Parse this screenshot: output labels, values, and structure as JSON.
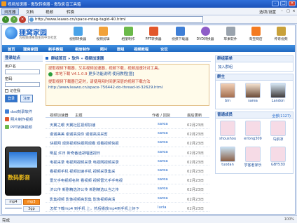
{
  "window": {
    "title": "视频加速器 - 傲软转换器 - 傲软影音工具箱"
  },
  "menubar": {
    "items": [
      "浏览器",
      "文档",
      "视频",
      "转换"
    ],
    "tool": "选项/设置"
  },
  "address": {
    "url": "http://www.leawo.cn/space-mtag-tagid-40.html"
  },
  "site": {
    "logo": "狸窝家园",
    "logo_sub": "为视频转换而生的中文社区",
    "top_icons": [
      "视频转换器",
      "视频剪辑",
      "相册制作",
      "PPT转换器",
      "视频下载器",
      "DVD转换器",
      "苹果软件",
      "淘宝网店",
      "传奇视频"
    ],
    "nav": [
      "首页",
      "狸窝家园",
      "新手教程",
      "相册制作",
      "照片",
      "群组",
      "视频教程",
      "论坛"
    ]
  },
  "login": {
    "title": "登录站点",
    "user_label": "用户名",
    "pass_label": "密码",
    "remember": "记住我",
    "login_btn": "登录",
    "register_btn": "注册"
  },
  "sidelinks": [
    "dvd刻录软件",
    "照片制作视频",
    "PPT转换视频"
  ],
  "device": {
    "brand": "数码影音"
  },
  "formats": [
    "mp4",
    "mp3",
    "",
    "3gp"
  ],
  "crumb": {
    "group": "群组首页",
    "sep1": "»",
    "cat": "软件",
    "sep2": "»",
    "current": "视频加速器"
  },
  "notice": {
    "line1": "提取视频下载器，又名视频加速器，视频下载，视频加速针对工具。",
    "version": "本地下载 V4.1.0.9",
    "version_more": "更多功能说明",
    "usage": "使用教程[图]",
    "line3": "提取视频下载器已定时，请使用网时间更深层的视频下载方法",
    "link": "http://www.leawo.cn/space-756442-do-thread-id-32629.html"
  },
  "table": {
    "headers": [
      "视频加速器",
      "主题",
      "作者 / 回复",
      "最后更新"
    ],
    "rows": [
      {
        "title": "天翼之眼 天翼社区视频加速",
        "author": "sarea",
        "date": "02月23日"
      },
      {
        "title": "谢谢美美 谢谢高清你 谢谢高清采剪",
        "author": "sarea",
        "date": "02月23日"
      },
      {
        "title": "快报网 观赏视频快报网观看 观看视频快报",
        "author": "sarea",
        "date": "02月23日"
      },
      {
        "title": "明星 红日 新奇番迪胡唱团视日",
        "author": "sarea",
        "date": "02月23日"
      },
      {
        "title": "电视采录 电视网视频采录 电视网视频采录",
        "author": "sarea",
        "date": "02月23日"
      },
      {
        "title": "看视频手机 视频加速手机 视频采录集采",
        "author": "sarea",
        "date": "02月23日"
      },
      {
        "title": "雷光手电视频名称 看视频 视频雷光手手电视",
        "author": "sarea",
        "date": "02月23日"
      },
      {
        "title": "济公传 新剧精选济公传 新剧精选以当之传",
        "author": "sarea",
        "date": "02月23日"
      },
      {
        "title": "影集视频 影像视频高影集 影像视频高清",
        "author": "sarea",
        "date": "02月23日"
      },
      {
        "title": "怎样下载mp4 到手机 上，然后播放mp4到手机上好下",
        "author": "lucia",
        "date": "02月23日"
      }
    ]
  },
  "right": {
    "menu_title": "群组菜单",
    "join": "加入群组",
    "owners_title": "群主",
    "owners": [
      "bin",
      "sarea",
      "Landon"
    ],
    "members_title": "普通成员",
    "members_count": "全部(1127)",
    "members": [
      "shoushou",
      "erlong309",
      "乌龄凉",
      "tuodan",
      "学客者家乐",
      "GBY53D"
    ]
  },
  "status": {
    "text": "完成",
    "zoom": "100%"
  },
  "colors": {
    "accent": "#1d64c8",
    "nav": "#2a77d2",
    "notice_bg": "#fffbea"
  }
}
